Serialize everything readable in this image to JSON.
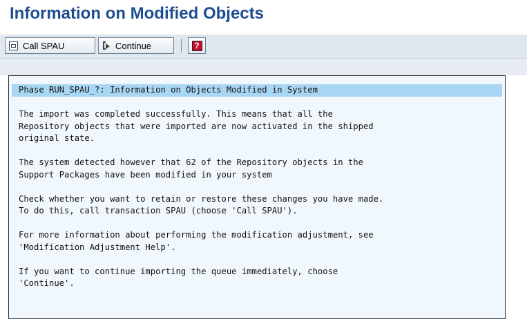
{
  "window": {
    "title": "Information on Modified Objects"
  },
  "toolbar": {
    "call_spau_label": "Call SPAU",
    "continue_label": "Continue",
    "help_glyph": "?"
  },
  "icons": {
    "call_spau": "window-icon",
    "continue": "continue-arrow-icon",
    "help": "help-icon"
  },
  "colors": {
    "title": "#1d4e8f",
    "highlight_row": "#a9d7f3",
    "panel_bg": "#f1f8fd",
    "help_icon": "#c8102e"
  },
  "message": {
    "lines": [
      "Phase RUN_SPAU_?: Information on Objects Modified in System",
      "",
      "The import was completed successfully. This means that all the",
      "Repository objects that were imported are now activated in the shipped",
      "original state.",
      "",
      "The system detected however that 62 of the Repository objects in the",
      "Support Packages have been modified in your system",
      "",
      "Check whether you want to retain or restore these changes you have made.",
      "To do this, call transaction SPAU (choose 'Call SPAU').",
      "",
      "For more information about performing the modification adjustment, see",
      "'Modification Adjustment Help'.",
      "",
      "If you want to continue importing the queue immediately, choose",
      "'Continue'."
    ]
  }
}
